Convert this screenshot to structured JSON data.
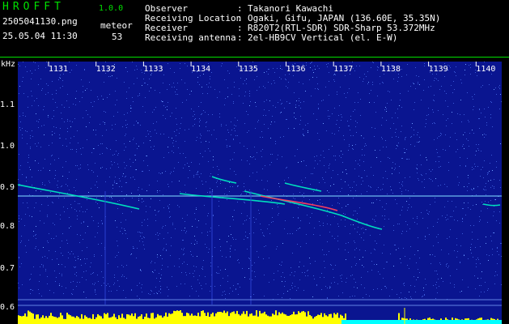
{
  "header": {
    "app_name": "HROFFT",
    "app_version": "1.0.0",
    "file_name": "2505041130.png",
    "timestamp": "25.05.04 11:30",
    "meteor_label": "meteor",
    "meteor_count": "53"
  },
  "info": [
    {
      "key": "Observer",
      "sep": ":",
      "value": "Takanori Kawachi"
    },
    {
      "key": "Receiving Location",
      "sep": ":",
      "value": "Ogaki, Gifu, JAPAN (136.60E, 35.35N)"
    },
    {
      "key": "Receiver",
      "sep": ":",
      "value": "R820T2(RTL-SDR) SDR-Sharp 53.372MHz"
    },
    {
      "key": "Receiving antenna",
      "sep": ":",
      "value": "2el-HB9CV Vertical (el. E-W)"
    }
  ],
  "spectrogram": {
    "y_unit": "kHz",
    "time_ticks": [
      "1131",
      "1132",
      "1133",
      "1134",
      "1135",
      "1136",
      "1137",
      "1138",
      "1139",
      "1140"
    ],
    "freq_ticks": [
      "1.1",
      "1.0",
      "0.9",
      "0.8",
      "0.7",
      "0.6"
    ],
    "colors": {
      "background": "#0a1590",
      "noise_dot": "#3a5ad8",
      "carrier": "#7fd8ff",
      "trail": "#00e8c0",
      "trail_hot": "#ff4060",
      "level_bar": "#ffff00",
      "level_base": "#00ffff",
      "frame_accent": "#00e000"
    }
  }
}
